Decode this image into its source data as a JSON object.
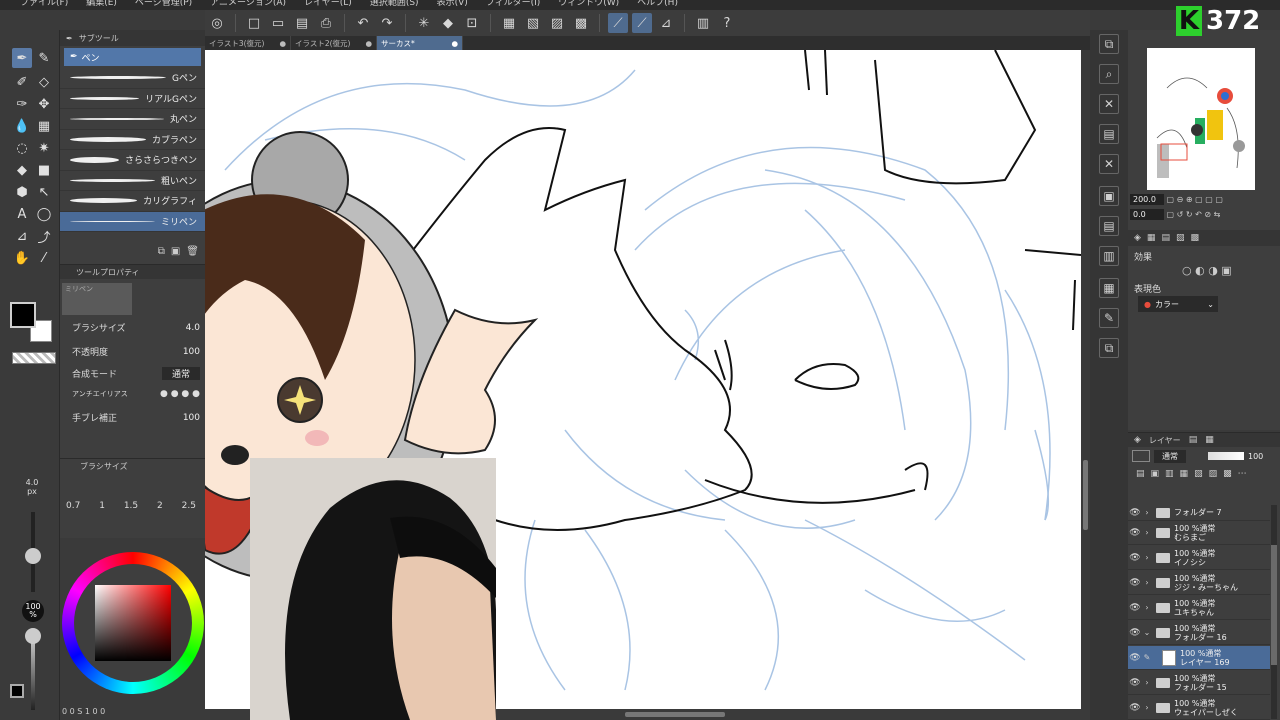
{
  "menu": [
    "ファイル(F)",
    "編集(E)",
    "ページ管理(P)",
    "アニメーション(A)",
    "レイヤー(L)",
    "選択範囲(S)",
    "表示(V)",
    "フィルター(I)",
    "ウィンドウ(W)",
    "ヘルプ(H)"
  ],
  "tabs": [
    {
      "label": "イラスト3(復元)",
      "active": false
    },
    {
      "label": "イラスト2(復元)",
      "active": false
    },
    {
      "label": "サーカス*",
      "active": true
    }
  ],
  "subtool": {
    "header": "サブツール",
    "group": "ペン",
    "brushes": [
      "Gペン",
      "リアルGペン",
      "丸ペン",
      "カブラペン",
      "さらさらつきペン",
      "粗いペン",
      "カリグラフィ",
      "ミリペン"
    ]
  },
  "toolprop": {
    "header": "ツールプロパティ",
    "preview_label": "ミリペン",
    "brush_size_label": "ブラシサイズ",
    "brush_size_value": "4.0",
    "opacity_label": "不透明度",
    "opacity_value": "100",
    "blend_label": "合成モード",
    "blend_value": "通常",
    "antialias_label": "アンチエイリアス",
    "stabilize_label": "手ブレ補正",
    "stabilize_value": "100"
  },
  "brushsize": {
    "header": "ブラシサイズ",
    "sizes": [
      "0.7",
      "1",
      "1.5",
      "2",
      "2.5"
    ],
    "current": "4.0",
    "unit": "px",
    "opacity_pct": "100",
    "opacity_unit": "%"
  },
  "statusbar": {
    "zoom": "200",
    "coords": "0  0 S  1  0  0"
  },
  "badge": {
    "letter": "K",
    "number": "372"
  },
  "navigator": {
    "zoom": "200.0",
    "angle": "0.0"
  },
  "layerprop": {
    "effect_label": "効果",
    "color_label": "表現色",
    "color_value": "カラー"
  },
  "layers": {
    "blend": "通常",
    "opacity": "100",
    "items": [
      {
        "line1": "",
        "line2": "フォルダー 7",
        "type": "folder",
        "active": false
      },
      {
        "line1": "100 %通常",
        "line2": "むらまご",
        "type": "folder",
        "active": false
      },
      {
        "line1": "100 %通常",
        "line2": "イノシシ",
        "type": "folder",
        "active": false
      },
      {
        "line1": "100 %通常",
        "line2": "ジジ・みーちゃん",
        "type": "folder",
        "active": false
      },
      {
        "line1": "100 %通常",
        "line2": "ユキちゃん",
        "type": "folder",
        "active": false
      },
      {
        "line1": "100 %通常",
        "line2": "フォルダー 16",
        "type": "folder-open",
        "active": false
      },
      {
        "line1": "100 %通常",
        "line2": "レイヤー 169",
        "type": "layer",
        "active": true
      },
      {
        "line1": "100 %通常",
        "line2": "フォルダー 15",
        "type": "folder",
        "active": false
      },
      {
        "line1": "100 %通常",
        "line2": "ウェイパーしぜく",
        "type": "folder",
        "active": false
      }
    ]
  },
  "colors": {
    "accent": "#4a6b98",
    "sketch": "#a9c4e4",
    "line": "#111111",
    "badge_green": "#2dd02d"
  }
}
